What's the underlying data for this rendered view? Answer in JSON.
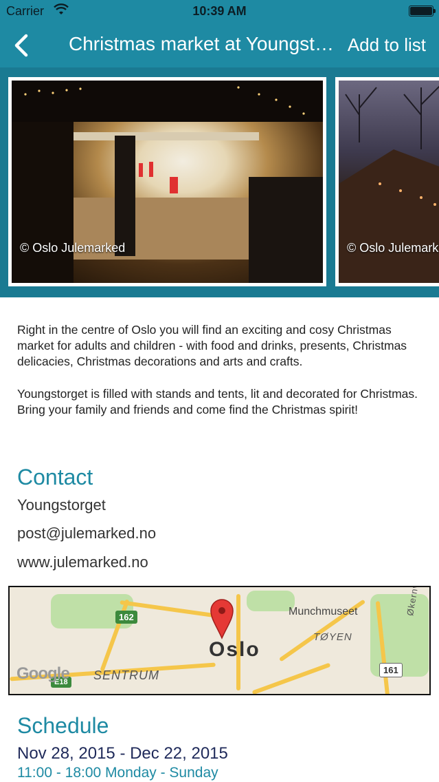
{
  "status_bar": {
    "carrier": "Carrier",
    "time": "10:39 AM",
    "icons": [
      "wifi-icon",
      "battery-icon"
    ]
  },
  "nav": {
    "back_icon": "chevron-left-icon",
    "title": "Christmas market at Youngsto...",
    "add_to_list": "Add to list"
  },
  "gallery": {
    "photos": [
      {
        "credit": "© Oslo Julemarked"
      },
      {
        "credit": "© Oslo Julemark"
      }
    ]
  },
  "description": {
    "paragraphs": [
      "Right in the centre of Oslo you will find an exciting and cosy Christmas market for adults and children - with food and drinks, presents, Christmas delicacies, Christmas decorations and arts and crafts.",
      "Youngstorget is filled with stands and tents, lit and decorated for Christmas. Bring your family and friends and come find the Christmas spirit!"
    ]
  },
  "contact": {
    "title": "Contact",
    "address": "Youngstorget",
    "email": "post@julemarked.no",
    "website": "www.julemarked.no"
  },
  "map": {
    "city": "Oslo",
    "labels": {
      "munchmuseet": "Munchmuseet",
      "toyen": "TØYEN",
      "sentrum": "SENTRUM",
      "okernveien": "Økernvei"
    },
    "road_shields": {
      "r162": "162",
      "r161": "161",
      "e18": "E18"
    },
    "attribution": "Google",
    "colors": {
      "pin": "#e53935",
      "roads": "#f5c64a",
      "parks": "#bfe0a7"
    }
  },
  "schedule": {
    "title": "Schedule",
    "dates": "Nov 28, 2015 - Dec 22, 2015",
    "hours": "11:00 - 18:00 Monday - Sunday"
  },
  "colors": {
    "accent": "#1e8aa3",
    "dates_text": "#1f2a5a"
  }
}
